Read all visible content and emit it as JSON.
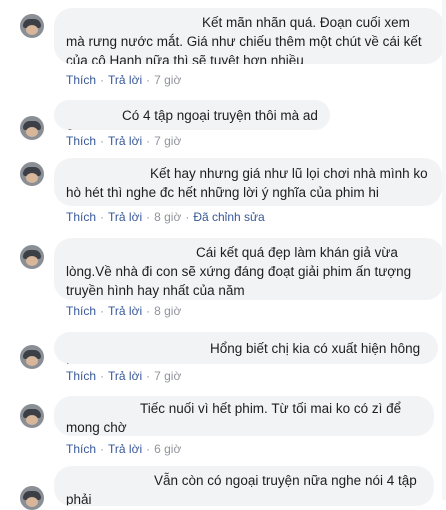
{
  "comments": [
    {
      "text": "Kết mãn nhãn quá. Đoạn cuối xem mà rưng nước mắt. Giá như chiếu thêm một chút về cái kết của cô Hạnh nữa thì sẽ tuyệt hơn nhiều",
      "like": "Thích",
      "reply": "Trả lời",
      "time": "7 giờ"
    },
    {
      "text": "Có 4 tập ngoại truyện thôi mà ad ?",
      "like": "Thích",
      "reply": "Trả lời",
      "time": "7 giờ"
    },
    {
      "text": "Kết hay nhưng giá như lũ lọi chơi nhà mình ko hò hét thì nghe đc hết những lời ý nghĩa của phim hi",
      "like": "Thích",
      "reply": "Trả lời",
      "time": "8 giờ",
      "edited": "Đã chỉnh sửa"
    },
    {
      "text": "Cái kết quá đẹp làm khán giả vừa lòng.Về nhà đi con sẽ xứng đáng đoạt giải phim ấn tượng truyền hình hay nhất của năm",
      "like": "Thích",
      "reply": "Trả lời",
      "time": "8 giờ"
    },
    {
      "text": "Hổng biết chị kia có xuất hiện hông ta",
      "like": "Thích",
      "reply": "Trả lời",
      "time": "7 giờ"
    },
    {
      "text": "Tiếc nuối vì hết phim. Từ tối mai ko có zì để mong chờ",
      "like": "Thích",
      "reply": "Trả lời",
      "time": "6 giờ"
    },
    {
      "text": "Vẫn còn có ngoại truyện nữa nghe nói 4 tập phải"
    }
  ]
}
